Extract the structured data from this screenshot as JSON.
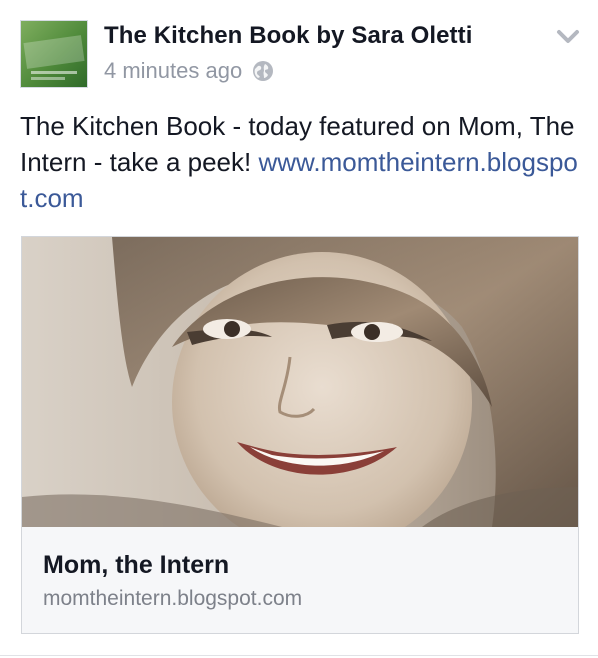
{
  "post": {
    "author": "The Kitchen Book by Sara Oletti",
    "timestamp": "4 minutes ago",
    "privacy_icon": "globe-icon",
    "menu_icon": "chevron-down-icon",
    "message": "The Kitchen Book - today featured on Mom, The Intern - take a peek!",
    "link_text": "www.momtheintern.blogspot.com"
  },
  "link_card": {
    "title": "Mom, the Intern",
    "domain": "momtheintern.blogspot.com"
  },
  "colors": {
    "link": "#3b5998",
    "meta": "#9197a3",
    "card_bg": "#f6f7f9"
  }
}
